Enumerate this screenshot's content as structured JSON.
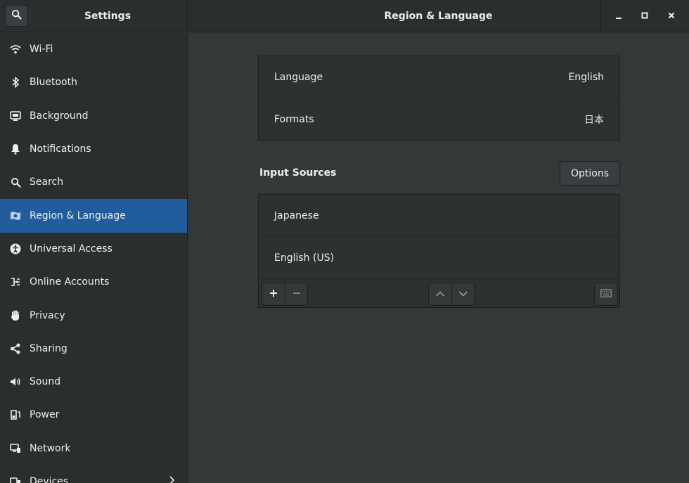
{
  "header": {
    "left_title": "Settings",
    "main_title": "Region & Language"
  },
  "sidebar": {
    "items": [
      {
        "label": "Wi-Fi",
        "icon": "wifi-icon"
      },
      {
        "label": "Bluetooth",
        "icon": "bluetooth-icon"
      },
      {
        "label": "Background",
        "icon": "background-icon"
      },
      {
        "label": "Notifications",
        "icon": "bell-icon"
      },
      {
        "label": "Search",
        "icon": "search-icon"
      },
      {
        "label": "Region & Language",
        "icon": "region-icon",
        "active": true
      },
      {
        "label": "Universal Access",
        "icon": "accessibility-icon"
      },
      {
        "label": "Online Accounts",
        "icon": "online-accounts-icon"
      },
      {
        "label": "Privacy",
        "icon": "hand-icon"
      },
      {
        "label": "Sharing",
        "icon": "share-icon"
      },
      {
        "label": "Sound",
        "icon": "speaker-icon"
      },
      {
        "label": "Power",
        "icon": "power-icon"
      },
      {
        "label": "Network",
        "icon": "network-icon"
      },
      {
        "label": "Devices",
        "icon": "devices-icon"
      }
    ]
  },
  "language_card": {
    "language_label": "Language",
    "language_value": "English",
    "formats_label": "Formats",
    "formats_value": "日本"
  },
  "input_sources": {
    "title": "Input Sources",
    "options_label": "Options",
    "sources": [
      "Japanese",
      "English (US)"
    ]
  },
  "colors": {
    "accent": "#215d9c",
    "background": "#353839",
    "sidebar": "#2b2e2f"
  }
}
